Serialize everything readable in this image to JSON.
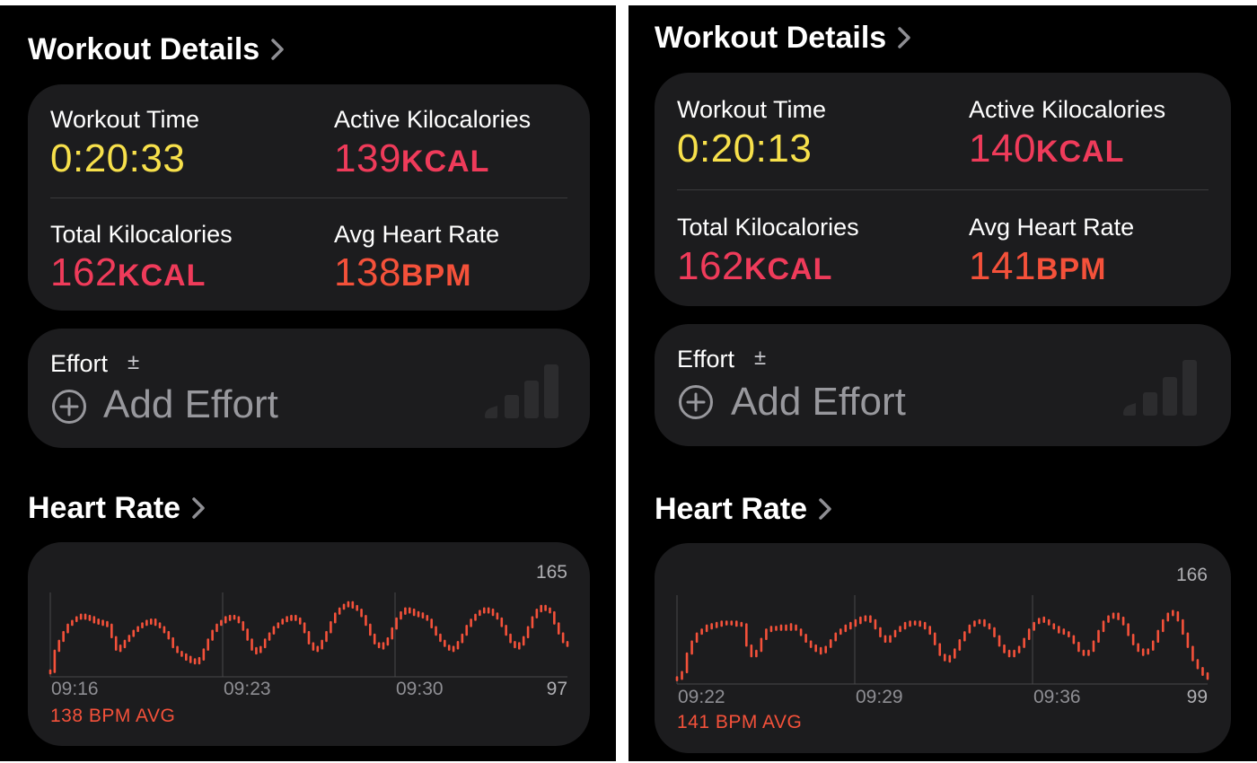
{
  "accent_colors": {
    "time": "#f7e04b",
    "kcal": "#ef3b5a",
    "bpm": "#f4513a",
    "card": "#1c1c1e"
  },
  "panels": [
    {
      "workout_details": {
        "title": "Workout Details",
        "chevron_icon": "chevron-right-icon",
        "workout_time_label": "Workout Time",
        "workout_time_value": "0:20:33",
        "active_kcal_label": "Active Kilocalories",
        "active_kcal_value": "139",
        "active_kcal_unit": "KCAL",
        "total_kcal_label": "Total Kilocalories",
        "total_kcal_value": "162",
        "total_kcal_unit": "KCAL",
        "avg_hr_label": "Avg Heart Rate",
        "avg_hr_value": "138",
        "avg_hr_unit": "BPM"
      },
      "effort": {
        "label": "Effort",
        "info_symbol": "±",
        "add_label": "Add Effort",
        "add_icon": "plus-circle-icon",
        "level_icon": "signal-bars-icon"
      },
      "heart_rate": {
        "title": "Heart Rate",
        "chevron_icon": "chevron-right-icon",
        "avg_label": "138 BPM AVG"
      }
    },
    {
      "workout_details": {
        "title": "Workout Details",
        "chevron_icon": "chevron-right-icon",
        "workout_time_label": "Workout Time",
        "workout_time_value": "0:20:13",
        "active_kcal_label": "Active Kilocalories",
        "active_kcal_value": "140",
        "active_kcal_unit": "KCAL",
        "total_kcal_label": "Total Kilocalories",
        "total_kcal_value": "162",
        "total_kcal_unit": "KCAL",
        "avg_hr_label": "Avg Heart Rate",
        "avg_hr_value": "141",
        "avg_hr_unit": "BPM"
      },
      "effort": {
        "label": "Effort",
        "info_symbol": "±",
        "add_label": "Add Effort",
        "add_icon": "plus-circle-icon",
        "level_icon": "signal-bars-icon"
      },
      "heart_rate": {
        "title": "Heart Rate",
        "chevron_icon": "chevron-right-icon",
        "avg_label": "141 BPM AVG"
      }
    }
  ],
  "chart_data": [
    {
      "type": "line",
      "color": "#f4513a",
      "x_tick_labels": [
        "09:16",
        "09:23",
        "09:30"
      ],
      "ylim": [
        97,
        165
      ],
      "y_max_label": "165",
      "y_min_label": "97",
      "grid": "vertical",
      "series": [
        {
          "values": [
            101,
            118,
            126,
            133,
            139,
            142,
            145,
            146,
            145,
            144,
            142,
            141,
            140,
            139,
            129,
            119,
            121,
            126,
            130,
            134,
            137,
            140,
            141,
            142,
            140,
            137,
            133,
            128,
            121,
            117,
            114,
            112,
            110,
            109,
            111,
            119,
            127,
            134,
            139,
            142,
            144,
            145,
            145,
            141,
            135,
            127,
            119,
            117,
            121,
            127,
            132,
            137,
            140,
            143,
            144,
            145,
            144,
            140,
            133,
            124,
            119,
            120,
            126,
            133,
            141,
            148,
            152,
            155,
            156,
            154,
            151,
            146,
            139,
            131,
            124,
            121,
            123,
            128,
            136,
            144,
            149,
            151,
            150,
            148,
            147,
            146,
            143,
            137,
            131,
            126,
            122,
            119,
            120,
            125,
            131,
            138,
            143,
            147,
            150,
            151,
            150,
            148,
            144,
            138,
            131,
            125,
            121,
            123,
            129,
            137,
            145,
            151,
            153,
            152,
            149,
            140,
            132,
            125,
            122
          ]
        }
      ]
    },
    {
      "type": "line",
      "color": "#f4513a",
      "x_tick_labels": [
        "09:22",
        "09:29",
        "09:36"
      ],
      "ylim": [
        99,
        166
      ],
      "y_max_label": "166",
      "y_min_label": "99",
      "grid": "vertical",
      "series": [
        {
          "values": [
            103,
            108,
            122,
            131,
            137,
            140,
            142,
            143,
            144,
            145,
            145,
            145,
            144,
            144,
            128,
            120,
            124,
            133,
            140,
            141,
            141,
            142,
            141,
            143,
            140,
            136,
            131,
            127,
            125,
            123,
            127,
            132,
            137,
            140,
            142,
            144,
            146,
            148,
            149,
            147,
            141,
            135,
            131,
            135,
            139,
            142,
            144,
            145,
            145,
            144,
            142,
            137,
            129,
            121,
            117,
            119,
            125,
            132,
            138,
            143,
            146,
            146,
            144,
            141,
            135,
            128,
            123,
            121,
            123,
            127,
            133,
            140,
            145,
            148,
            147,
            144,
            141,
            139,
            138,
            135,
            130,
            124,
            121,
            124,
            131,
            139,
            146,
            150,
            151,
            149,
            144,
            136,
            129,
            124,
            122,
            125,
            131,
            139,
            147,
            152,
            153,
            147,
            137,
            127,
            117,
            111,
            106,
            104
          ]
        }
      ]
    }
  ]
}
